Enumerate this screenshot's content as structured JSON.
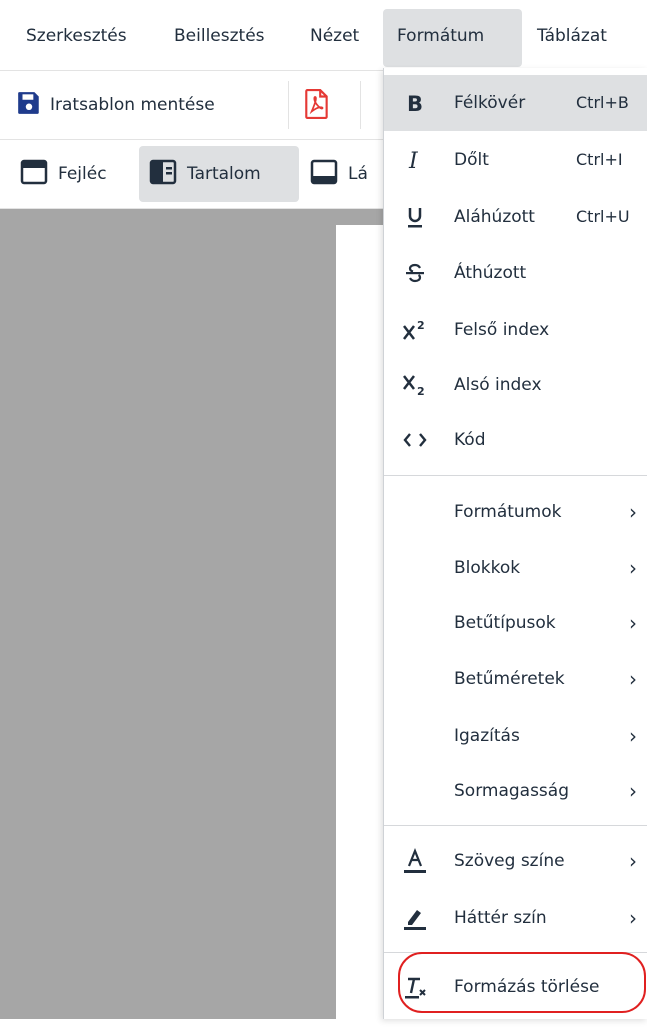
{
  "menubar": {
    "items": [
      "Szerkesztés",
      "Beillesztés",
      "Nézet",
      "Formátum",
      "Táblázat"
    ],
    "active": "Formátum"
  },
  "toolbar1": {
    "save_label": "Iratsablon mentése",
    "save_icon": "save-icon",
    "pdf_icon": "pdf-icon"
  },
  "toolbar2": {
    "header_label": "Fejléc",
    "content_label": "Tartalom",
    "footer_label": "Lábléc",
    "footer_visible_text": "Lá"
  },
  "format_menu": {
    "items": [
      {
        "icon": "bold-icon",
        "label": "Félkövér",
        "shortcut": "Ctrl+B"
      },
      {
        "icon": "italic-icon",
        "label": "Dőlt",
        "shortcut": "Ctrl+I"
      },
      {
        "icon": "underline-icon",
        "label": "Aláhúzott",
        "shortcut": "Ctrl+U"
      },
      {
        "icon": "strikethrough-icon",
        "label": "Áthúzott"
      },
      {
        "icon": "superscript-icon",
        "label": "Felső index"
      },
      {
        "icon": "subscript-icon",
        "label": "Alsó index"
      },
      {
        "icon": "code-icon",
        "label": "Kód"
      }
    ],
    "submenus": [
      {
        "label": "Formátumok"
      },
      {
        "label": "Blokkok"
      },
      {
        "label": "Betűtípusok"
      },
      {
        "label": "Betűméretek"
      },
      {
        "label": "Igazítás"
      },
      {
        "label": "Sormagasság"
      }
    ],
    "color_items": [
      {
        "icon": "text-color-icon",
        "label": "Szöveg színe"
      },
      {
        "icon": "background-color-icon",
        "label": "Háttér szín"
      }
    ],
    "clear": {
      "icon": "clear-formatting-icon",
      "label": "Formázás törlése"
    }
  },
  "colors": {
    "save_icon": "#1f3b8c",
    "pdf_icon": "#e53935",
    "highlight": "#e02020",
    "editor_bg": "#a6a6a6"
  }
}
